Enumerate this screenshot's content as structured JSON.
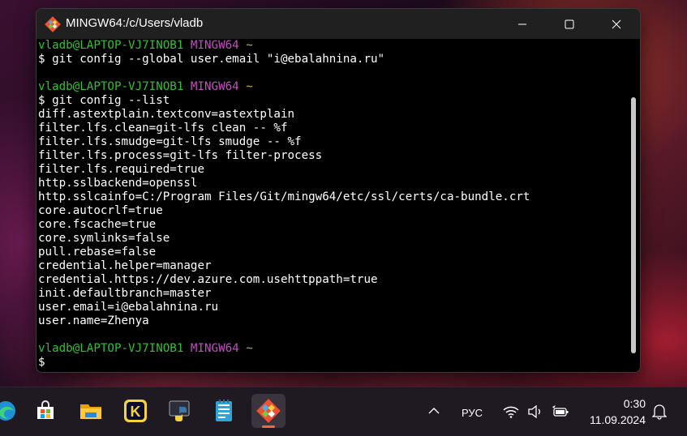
{
  "window": {
    "title": "MINGW64:/c/Users/vladb",
    "controls": {
      "minimize": "minimize",
      "maximize": "maximize",
      "close": "close"
    }
  },
  "terminal": {
    "lines": [
      {
        "kind": "prompt",
        "user": "vladb@LAPTOP-VJ7INOB1",
        "host": "MINGW64",
        "path": "~"
      },
      {
        "kind": "text",
        "text": "$ git config --global user.email \"i@ebalahnina.ru\""
      },
      {
        "kind": "blank",
        "text": ""
      },
      {
        "kind": "prompt",
        "user": "vladb@LAPTOP-VJ7INOB1",
        "host": "MINGW64",
        "path": "~"
      },
      {
        "kind": "text",
        "text": "$ git config --list"
      },
      {
        "kind": "text",
        "text": "diff.astextplain.textconv=astextplain"
      },
      {
        "kind": "text",
        "text": "filter.lfs.clean=git-lfs clean -- %f"
      },
      {
        "kind": "text",
        "text": "filter.lfs.smudge=git-lfs smudge -- %f"
      },
      {
        "kind": "text",
        "text": "filter.lfs.process=git-lfs filter-process"
      },
      {
        "kind": "text",
        "text": "filter.lfs.required=true"
      },
      {
        "kind": "text",
        "text": "http.sslbackend=openssl"
      },
      {
        "kind": "text",
        "text": "http.sslcainfo=C:/Program Files/Git/mingw64/etc/ssl/certs/ca-bundle.crt"
      },
      {
        "kind": "text",
        "text": "core.autocrlf=true"
      },
      {
        "kind": "text",
        "text": "core.fscache=true"
      },
      {
        "kind": "text",
        "text": "core.symlinks=false"
      },
      {
        "kind": "text",
        "text": "pull.rebase=false"
      },
      {
        "kind": "text",
        "text": "credential.helper=manager"
      },
      {
        "kind": "text",
        "text": "credential.https://dev.azure.com.usehttppath=true"
      },
      {
        "kind": "text",
        "text": "init.defaultbranch=master"
      },
      {
        "kind": "text",
        "text": "user.email=i@ebalahnina.ru"
      },
      {
        "kind": "text",
        "text": "user.name=Zhenya"
      },
      {
        "kind": "blank",
        "text": ""
      },
      {
        "kind": "prompt",
        "user": "vladb@LAPTOP-VJ7INOB1",
        "host": "MINGW64",
        "path": "~"
      },
      {
        "kind": "text",
        "text": "$"
      }
    ],
    "colors": {
      "user": "#2fc22f",
      "host": "#c34fc3",
      "path": "#c2b32f",
      "text": "#ffffff",
      "background": "#000000"
    }
  },
  "taskbar": {
    "apps": [
      {
        "name": "edge-icon",
        "label": "Microsoft Edge"
      },
      {
        "name": "store-icon",
        "label": "Microsoft Store"
      },
      {
        "name": "file-explorer-icon",
        "label": "File Explorer"
      },
      {
        "name": "kaspersky-icon",
        "label": "K"
      },
      {
        "name": "python-icon",
        "label": "Python"
      },
      {
        "name": "notepad-icon",
        "label": "Notepad"
      },
      {
        "name": "git-bash-icon",
        "label": "Git Bash",
        "active": true
      }
    ],
    "tray": {
      "language": "РУС",
      "time": "0:30",
      "date": "11.09.2024"
    }
  }
}
